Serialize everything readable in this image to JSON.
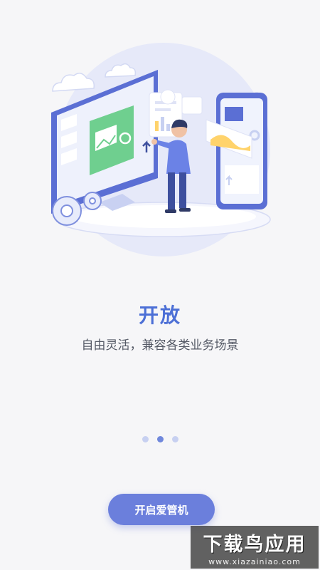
{
  "onboarding": {
    "title": "开放",
    "subtitle": "自由灵活，兼容各类业务场景",
    "pager": {
      "total": 3,
      "active_index": 1
    },
    "start_button_label": "开启爱管机"
  },
  "watermark": {
    "text": "下载鸟应用",
    "url": "www.xiazainiao.com"
  },
  "colors": {
    "accent": "#4c6fd6",
    "button": "#6b7fdc",
    "dot_active": "#7088dc",
    "dot_inactive": "#c7d0f1",
    "background": "#f6f6f8"
  },
  "icons": {
    "illustration": "person-with-monitor-and-tablet-illustration",
    "clouds": "cloud-icon",
    "gears": "gear-icon",
    "arrow": "arrow-up-icon"
  }
}
